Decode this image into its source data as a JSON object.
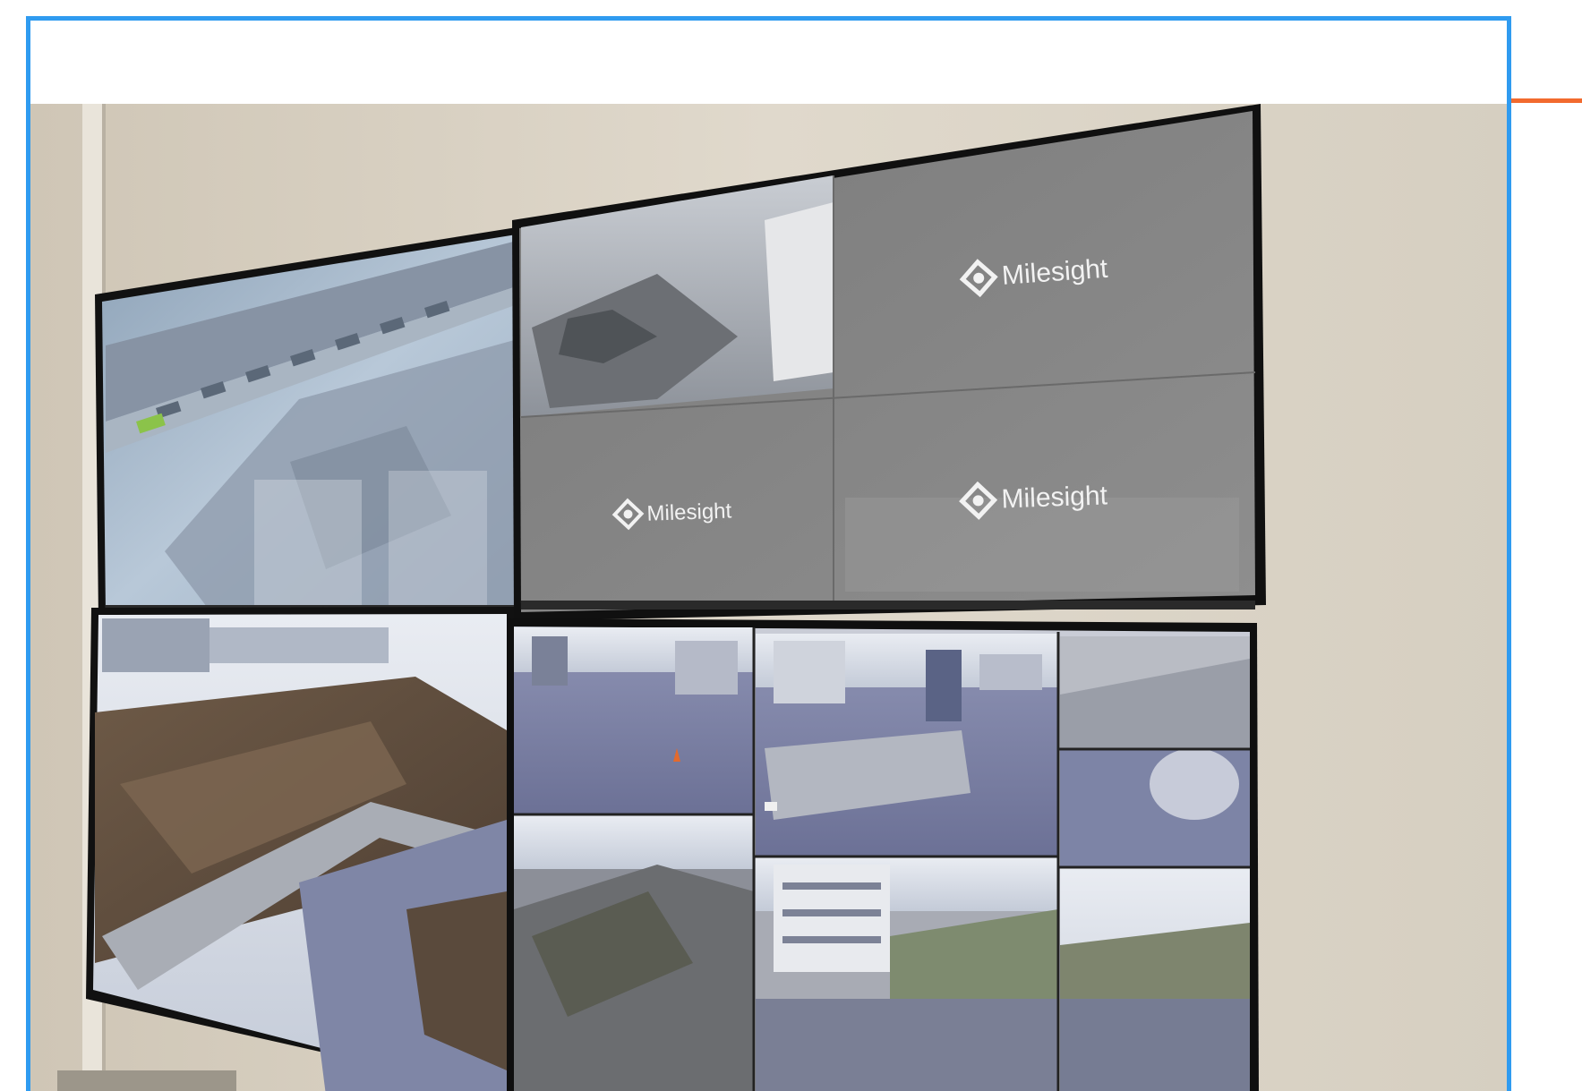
{
  "photo": {
    "subject": "",
    "watermarks": {
      "logo_1": "Milesight",
      "logo_2": "Milesight",
      "logo_3": "Milesight"
    }
  },
  "colors": {
    "card_border": "#2f9bf0",
    "accent_line": "#f26a2e",
    "wall": "#d8d0c2",
    "monitor_frame": "#121212"
  }
}
